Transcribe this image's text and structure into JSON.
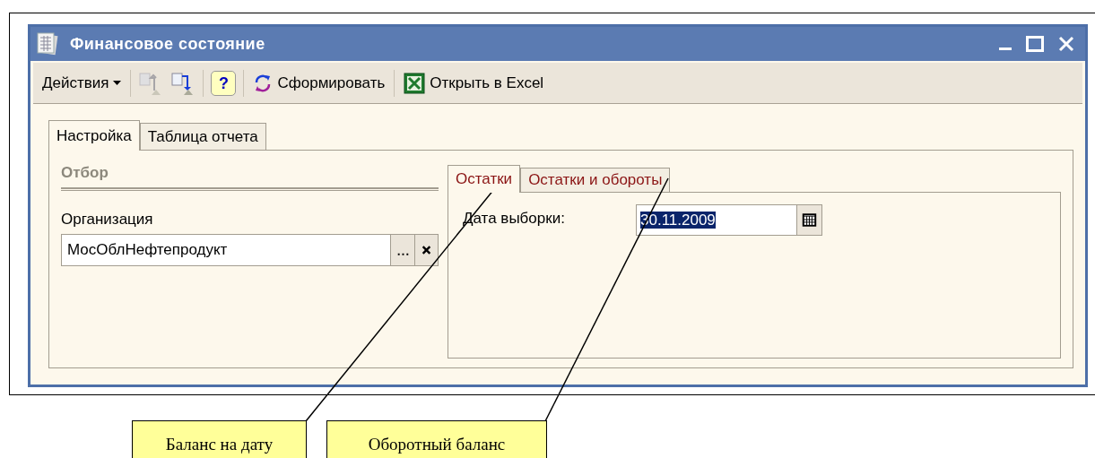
{
  "window": {
    "title": "Финансовое состояние"
  },
  "toolbar": [
    {
      "kind": "menu",
      "label": "Действия"
    },
    {
      "kind": "help",
      "label": "?"
    },
    {
      "kind": "refresh",
      "label": "Сформировать"
    },
    {
      "kind": "excel",
      "label": "Открыть в Excel"
    }
  ],
  "tabs": [
    {
      "label": "Настройка",
      "selected": true
    },
    {
      "label": "Таблица отчета",
      "selected": false
    }
  ],
  "filter": {
    "heading": "Отбор",
    "field_label": "Организация",
    "value": "МосОблНефтепродукт"
  },
  "inner_tabs": [
    {
      "label": "Остатки",
      "selected": true
    },
    {
      "label": "Остатки и обороты",
      "selected": false
    }
  ],
  "date": {
    "label": "Дата выборки:",
    "value": "30.11.2009",
    "selected": true
  },
  "callouts": [
    {
      "text": "Баланс на дату"
    },
    {
      "text": "Оборотный баланс"
    }
  ]
}
